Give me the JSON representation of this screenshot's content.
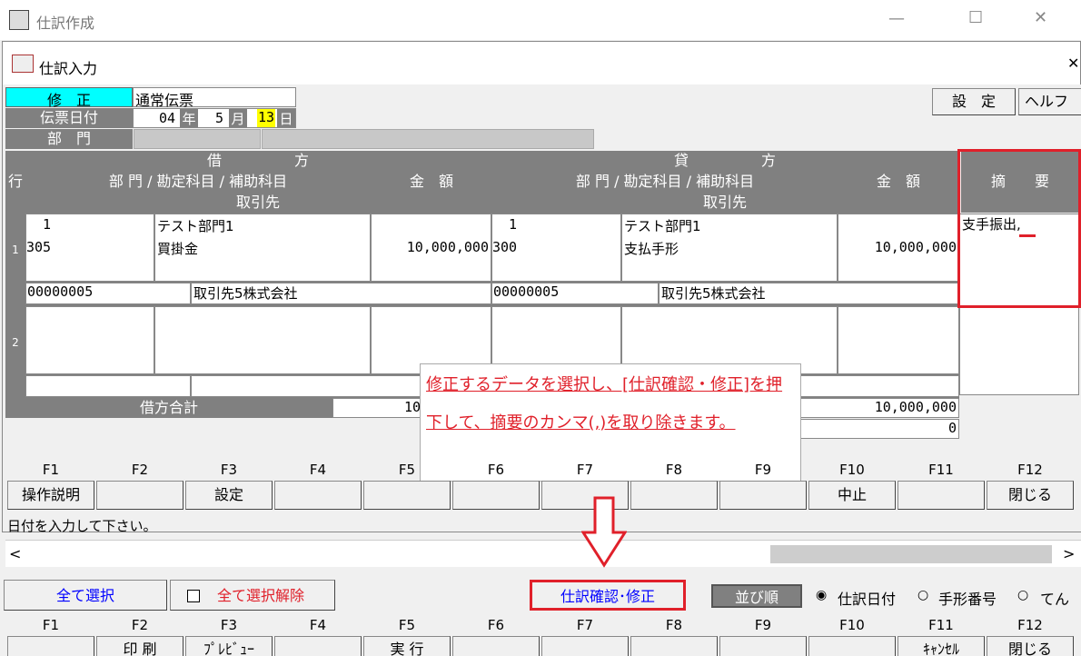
{
  "outer": {
    "title": "仕訳作成",
    "minimize": "—",
    "maximize": "☐",
    "close": "✕"
  },
  "inner": {
    "title": "仕訳入力",
    "close": "✕"
  },
  "form": {
    "mode": "修　正",
    "slip_type": "通常伝票",
    "date_label": "伝票日付",
    "year": "04",
    "year_unit": "年",
    "month": "5",
    "month_unit": "月",
    "day": "13",
    "day_unit": "日",
    "dept_label": "部　門"
  },
  "buttons": {
    "settings": "設　定",
    "help": "ヘルフ"
  },
  "grid": {
    "row_header": "行",
    "debit": "借　　　　　方",
    "credit": "貸　　　　　方",
    "debit_sub": "部 門 / 勘定科目 / 補助科目",
    "credit_sub": "部 門 / 勘定科目 / 補助科目",
    "amount": "金　額",
    "amount2": "金　額",
    "partner": "取引先",
    "partner2": "取引先",
    "memo": "摘　　要",
    "rows": [
      {
        "no": "1",
        "debit_dept_code": "1",
        "debit_dept": "テスト部門1",
        "debit_acct_code": "305",
        "debit_acct": "買掛金",
        "debit_amount": "10,000,000",
        "credit_dept_code": "1",
        "credit_dept": "テスト部門1",
        "credit_acct_code": "300",
        "credit_acct": "支払手形",
        "credit_amount": "10,000,000",
        "memo": "支手振出,",
        "debit_partner_code": "00000005",
        "debit_partner": "取引先5株式会社",
        "credit_partner_code": "00000005",
        "credit_partner": "取引先5株式会社"
      },
      {
        "no": "2"
      }
    ],
    "debit_total_label": "借方合計",
    "debit_total": "10",
    "credit_total": "10,000,000",
    "diff": "0"
  },
  "callout": {
    "text": "修正するデータを選択し、[仕訳確認・修正]を押下して、摘要のカンマ(,)を取り除きます。"
  },
  "fkeys1": {
    "labels": [
      "F1",
      "F2",
      "F3",
      "F4",
      "F5",
      "F6",
      "F7",
      "F8",
      "F9",
      "F10",
      "F11",
      "F12"
    ],
    "actions": [
      "操作説明",
      "",
      "設定",
      "",
      "",
      "",
      "",
      "",
      "",
      "中止",
      "",
      "閉じる"
    ]
  },
  "status": "日付を入力して下さい。",
  "bottom": {
    "select_all": "全て選択",
    "deselect_all": "全て選択解除",
    "confirm": "仕訳確認･修正",
    "sort_label": "並び順",
    "sort_opt1": "仕訳日付",
    "sort_opt2": "手形番号",
    "sort_opt3": "てん"
  },
  "fkeys2": {
    "labels": [
      "F1",
      "F2",
      "F3",
      "F4",
      "F5",
      "F6",
      "F7",
      "F8",
      "F9",
      "F10",
      "F11",
      "F12"
    ],
    "actions": [
      "",
      "印 刷",
      "ﾌﾟﾚﾋﾞｭｰ",
      "",
      "実 行",
      "",
      "",
      "",
      "",
      "",
      "ｷｬﾝｾﾙ",
      "閉じる"
    ]
  },
  "colors": {
    "accent_cyan": "#00ffff",
    "highlight_red": "#e0202a",
    "link_blue": "#0000ff"
  }
}
